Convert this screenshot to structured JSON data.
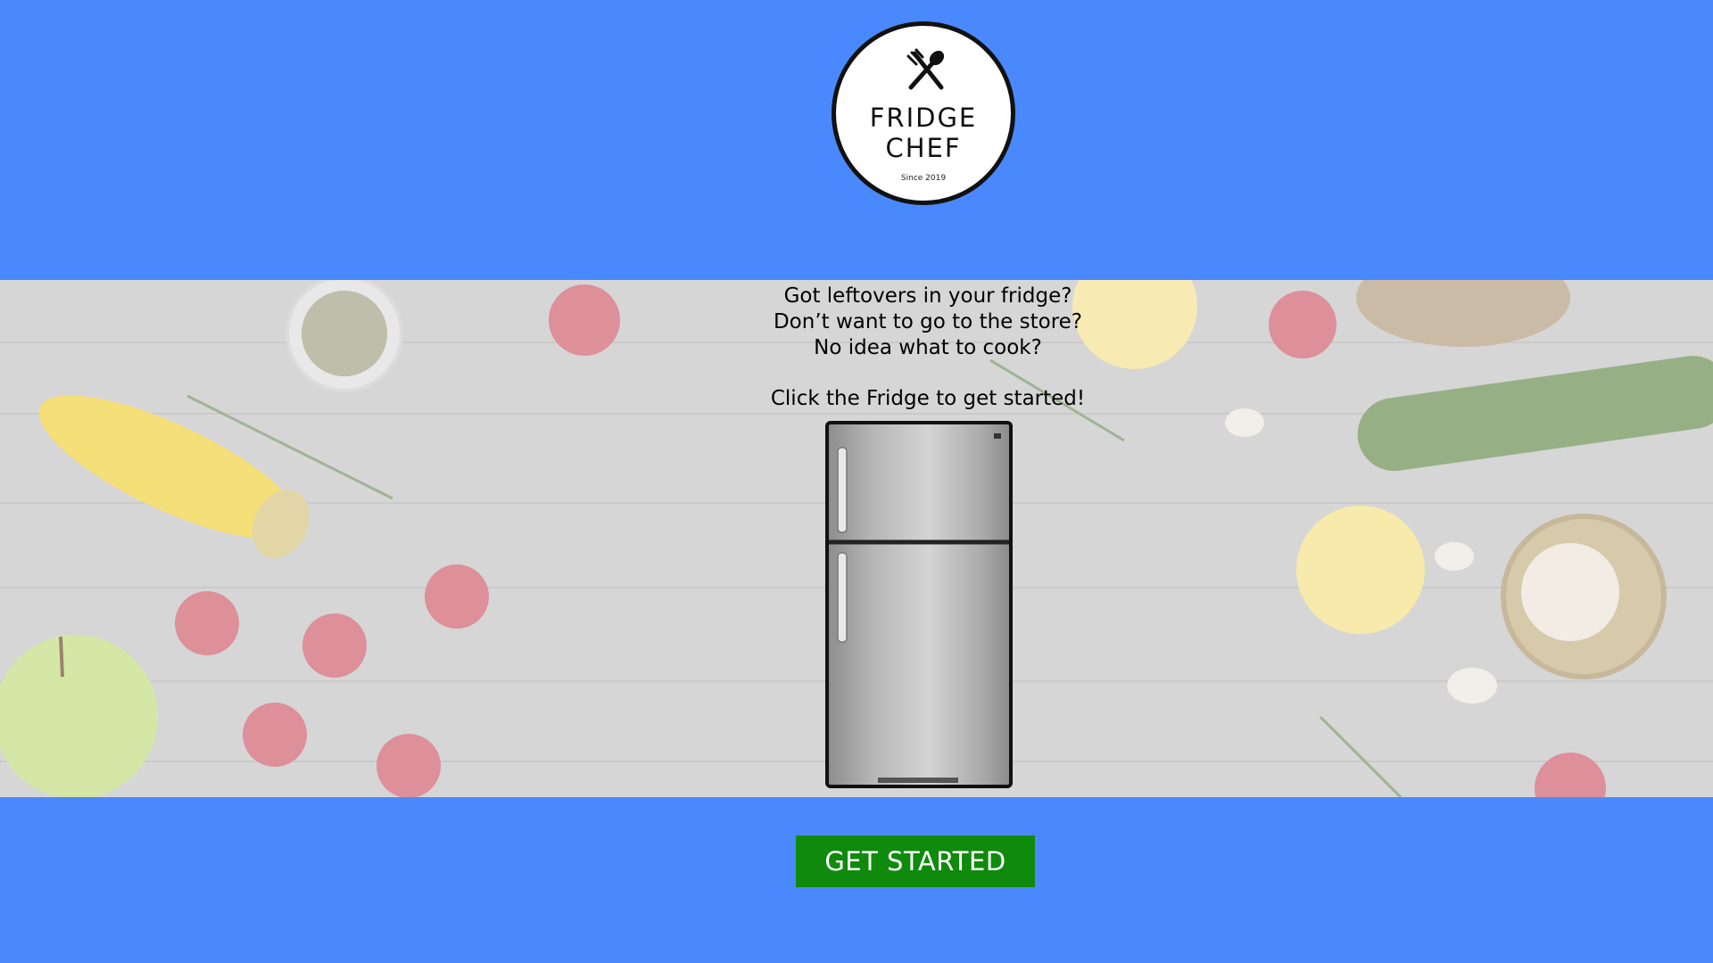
{
  "brand": {
    "line1": "FRIDGE",
    "line2": "CHEF",
    "since": "Since 2019",
    "icon": "fork-spoon-crossed-icon"
  },
  "hero": {
    "lines": [
      "Got leftovers in your fridge?",
      "Don’t want to go to the store?",
      "No idea what to cook?"
    ],
    "prompt": "Click the Fridge to get started!",
    "image": "refrigerator-image"
  },
  "cta": {
    "label": "GET STARTED"
  },
  "colors": {
    "page_background": "#4a89fd",
    "cta_background": "#108a0d",
    "cta_text": "#ffffff"
  }
}
